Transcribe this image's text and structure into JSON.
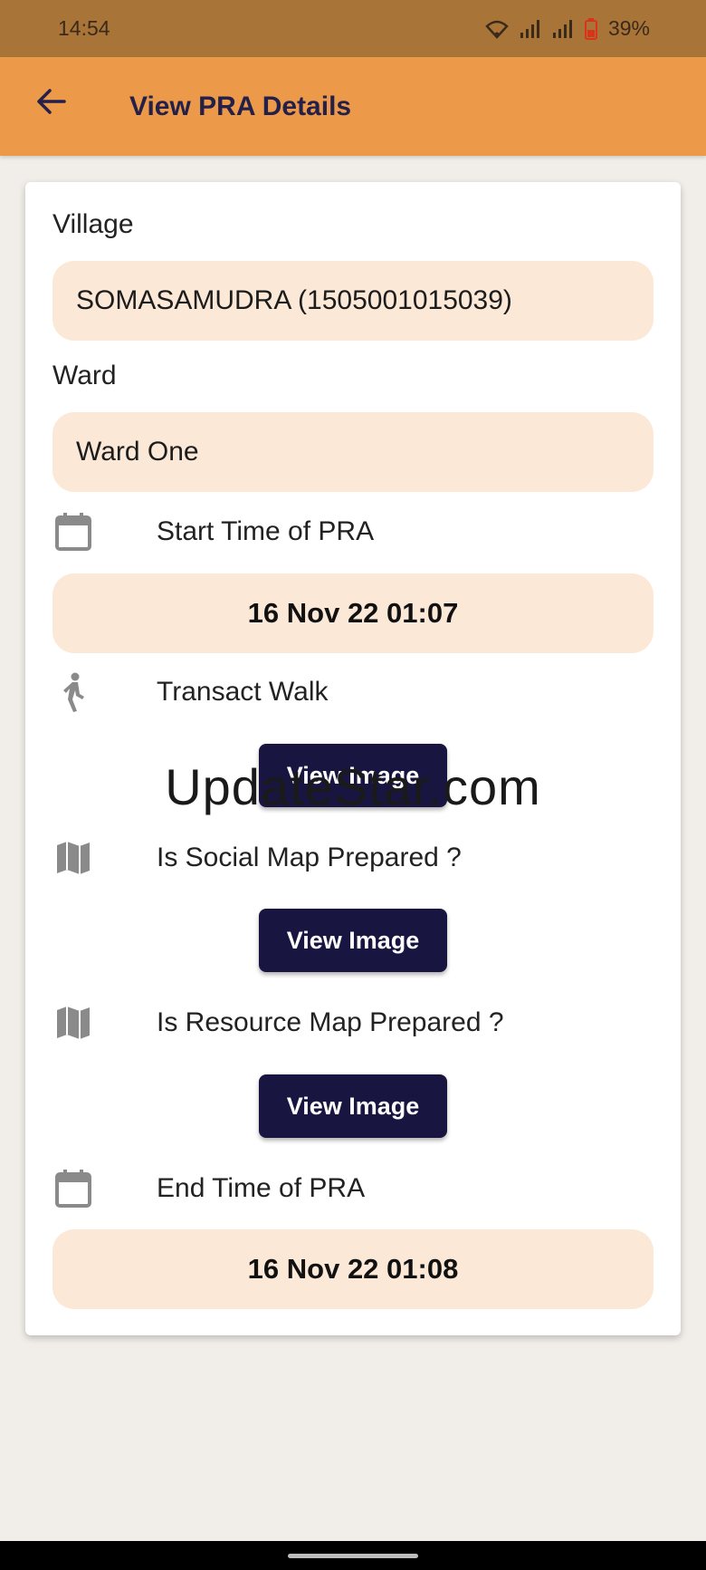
{
  "status_bar": {
    "time": "14:54",
    "battery": "39%"
  },
  "app_bar": {
    "title": "View PRA Details",
    "back_icon": "arrow-left-icon"
  },
  "form": {
    "village_label": "Village",
    "village_value": "SOMASAMUDRA (1505001015039)",
    "ward_label": "Ward",
    "ward_value": "Ward One",
    "start_label": "Start Time of PRA",
    "start_value": "16 Nov 22 01:07",
    "transact_label": "Transact Walk",
    "transact_button": "View Image",
    "social_label": "Is Social Map Prepared ?",
    "social_button": "View Image",
    "resource_label": "Is Resource Map Prepared ?",
    "resource_button": "View Image",
    "end_label": "End Time of PRA",
    "end_value": "16 Nov 22 01:08"
  },
  "watermark": "UpdateStar.com",
  "colors": {
    "status_bar": "#a97438",
    "app_bar": "#ec9a49",
    "title_text": "#24204a",
    "field_bg": "#fbe8d7",
    "button_bg": "#181640"
  }
}
